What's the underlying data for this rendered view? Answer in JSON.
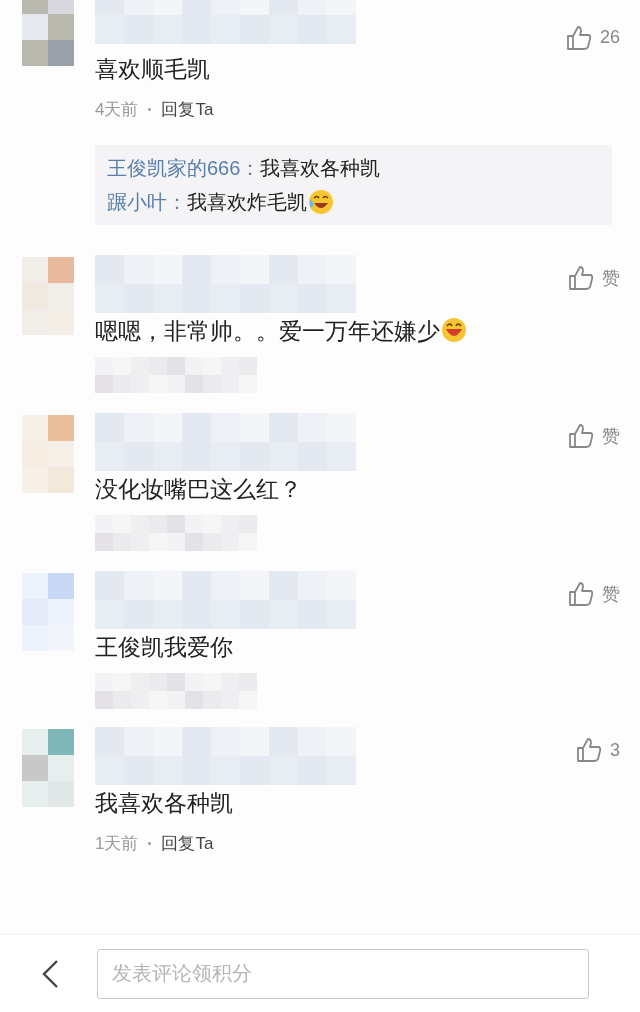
{
  "comments": [
    {
      "text": "喜欢顺毛凯",
      "emoji": false,
      "likes": "26",
      "meta_obscured": false,
      "time": "4天前",
      "reply_label": "回复Ta",
      "replies": [
        {
          "author": "王俊凯家的666：",
          "text": "我喜欢各种凯",
          "emoji": false
        },
        {
          "author": "蹍小叶：",
          "text": "我喜欢炸毛凯",
          "emoji": true
        }
      ]
    },
    {
      "text": "嗯嗯，非常帅。。爱一万年还嫌少",
      "emoji": true,
      "likes": "赞",
      "meta_obscured": true
    },
    {
      "text": "没化妆嘴巴这么红？",
      "emoji": false,
      "likes": "赞",
      "meta_obscured": true
    },
    {
      "text": "王俊凯我爱你",
      "emoji": false,
      "likes": "赞",
      "meta_obscured": true
    },
    {
      "text": "我喜欢各种凯",
      "emoji": false,
      "likes": "3",
      "meta_obscured": false,
      "time": "1天前",
      "reply_label": "回复Ta"
    }
  ],
  "input": {
    "placeholder": "发表评论领积分"
  }
}
